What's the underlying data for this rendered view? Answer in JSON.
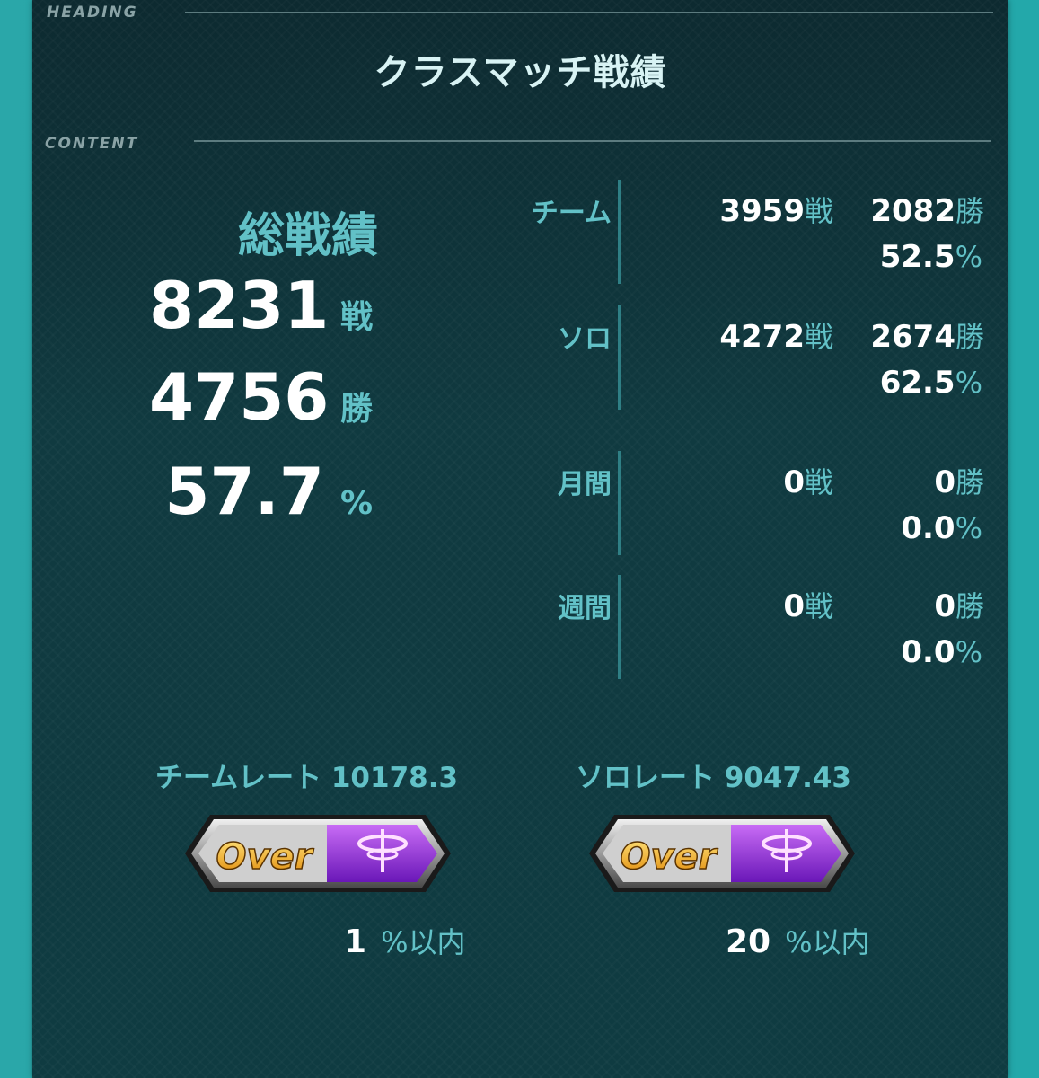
{
  "sections": {
    "heading": "HEADING",
    "content": "CONTENT"
  },
  "title": "クラスマッチ戦績",
  "total": {
    "label": "総戦績",
    "battles": "8231",
    "battles_unit": "戦",
    "wins": "4756",
    "wins_unit": "勝",
    "rate": "57.7",
    "rate_unit": "%"
  },
  "stats": [
    {
      "label": "チーム",
      "battles": "3959",
      "wins": "2082",
      "rate": "52.5"
    },
    {
      "label": "ソロ",
      "battles": "4272",
      "wins": "2674",
      "rate": "62.5"
    },
    {
      "label": "月間",
      "battles": "0",
      "wins": "0",
      "rate": "0.0"
    },
    {
      "label": "週間",
      "battles": "0",
      "wins": "0",
      "rate": "0.0"
    }
  ],
  "units": {
    "battle": "戦",
    "win": "勝",
    "percent": "%"
  },
  "team_rate": {
    "label": "チームレート 10178.3",
    "badge_text": "Over",
    "rank": "1",
    "rank_unit": "%以内"
  },
  "solo_rate": {
    "label": "ソロレート 9047.43",
    "badge_text": "Over",
    "rank": "20",
    "rank_unit": "%以内"
  },
  "colors": {
    "accent": "#62c1c7",
    "background": "#0f3b41",
    "frame": "#23a8aa",
    "badge_purple": "#8a2bd0",
    "badge_gold": "#f2b01e"
  },
  "icons": {
    "badge_emblem": "purple-emblem-icon"
  }
}
